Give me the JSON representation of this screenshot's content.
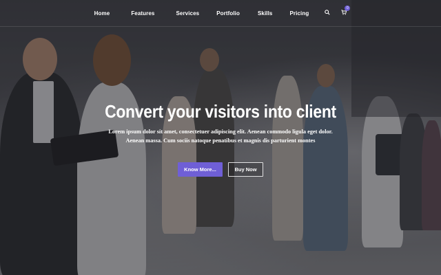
{
  "nav": {
    "items": [
      "Home",
      "Features",
      "Services",
      "Portfolio",
      "Skills",
      "Pricing"
    ],
    "search_icon": "search-icon",
    "cart_icon": "cart-icon",
    "cart_count": "0"
  },
  "hero": {
    "title": "Convert your visitors into client",
    "text": "Lorem ipsum dolor sit amet, consectetuer adipiscing elit. Aenean commodo ligula eget dolor. Aenean massa. Cum sociis natoque penatibus et magnis dis parturient montes",
    "primary_button": "Know More...",
    "secondary_button": "Buy Now"
  },
  "colors": {
    "accent": "#6f5fd6",
    "overlay": "#1e1e23"
  }
}
